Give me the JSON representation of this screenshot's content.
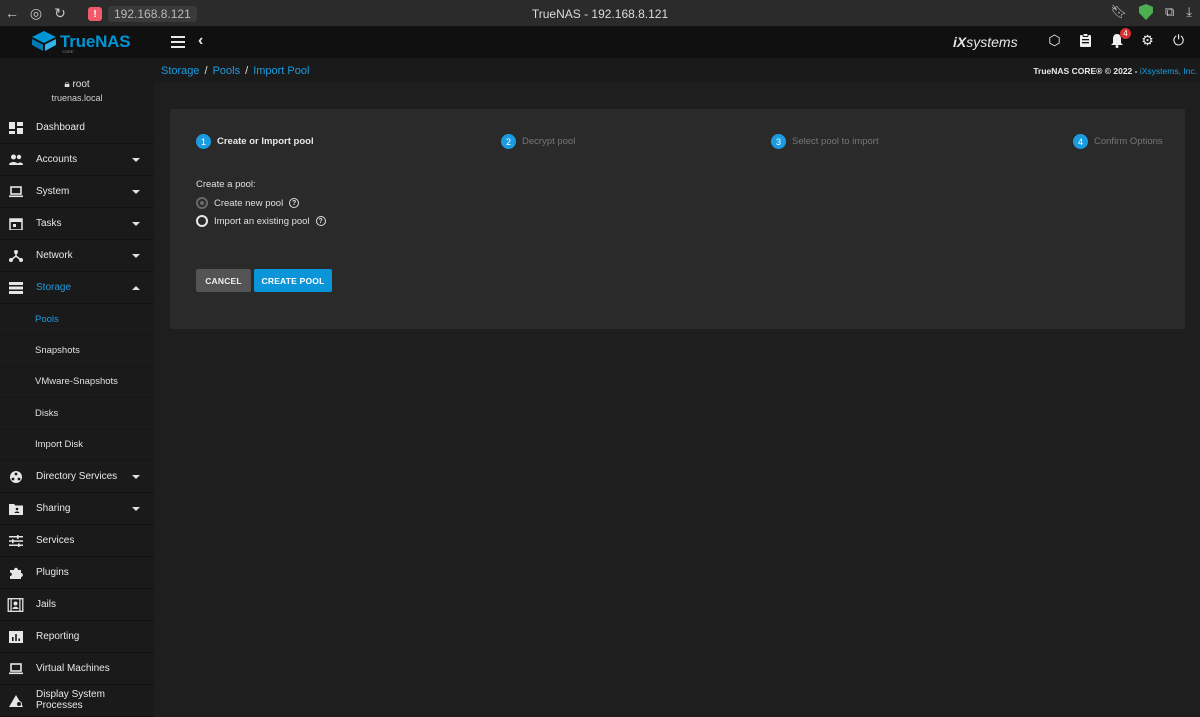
{
  "browser": {
    "url": "192.168.8.121",
    "title": "TrueNAS - 192.168.8.121"
  },
  "topbar": {
    "brand": "TrueNAS",
    "brand_sub": "CORE",
    "vendor_prefix": "iX",
    "vendor_suffix": "systems",
    "notification_count": "4"
  },
  "user": {
    "name": "root",
    "host": "truenas.local"
  },
  "sidebar": {
    "items": [
      {
        "label": "Dashboard"
      },
      {
        "label": "Accounts"
      },
      {
        "label": "System"
      },
      {
        "label": "Tasks"
      },
      {
        "label": "Network"
      },
      {
        "label": "Storage"
      },
      {
        "label": "Directory Services"
      },
      {
        "label": "Sharing"
      },
      {
        "label": "Services"
      },
      {
        "label": "Plugins"
      },
      {
        "label": "Jails"
      },
      {
        "label": "Reporting"
      },
      {
        "label": "Virtual Machines"
      },
      {
        "label": "Display System Processes"
      }
    ],
    "storage_sub": [
      "Pools",
      "Snapshots",
      "VMware-Snapshots",
      "Disks",
      "Import Disk"
    ]
  },
  "breadcrumb": [
    "Storage",
    "Pools",
    "Import Pool"
  ],
  "copyright": {
    "text": "TrueNAS CORE® © 2022 - ",
    "link": "iXsystems, Inc."
  },
  "wizard": {
    "steps": [
      {
        "num": "1",
        "label": "Create or Import pool"
      },
      {
        "num": "2",
        "label": "Decrypt pool"
      },
      {
        "num": "3",
        "label": "Select pool to import"
      },
      {
        "num": "4",
        "label": "Confirm Options"
      }
    ],
    "form_title": "Create a pool:",
    "option_create": "Create new pool",
    "option_import": "Import an existing pool",
    "help_glyph": "?",
    "cancel_label": "CANCEL",
    "create_label": "CREATE POOL"
  },
  "colors": {
    "accent": "#0095d5",
    "badge": "#d32f2f"
  }
}
